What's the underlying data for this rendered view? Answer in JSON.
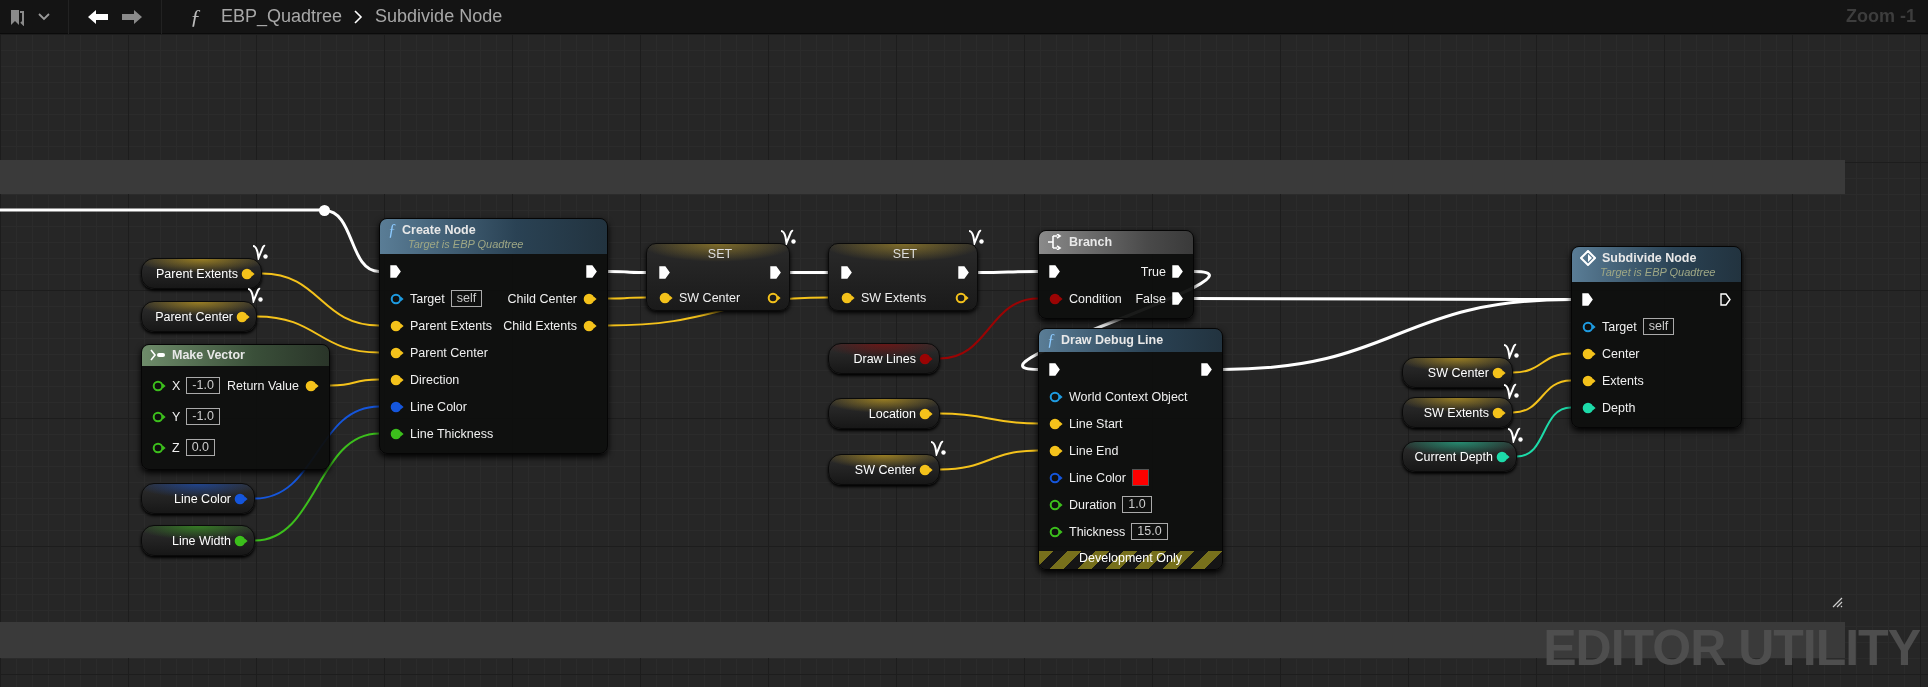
{
  "toolbar": {
    "function_glyph": "ƒ",
    "breadcrumb": [
      {
        "label": "EBP_Quadtree"
      },
      {
        "label": "Subdivide Node"
      }
    ],
    "zoom": "Zoom -1"
  },
  "graph_label": "EDITOR UTILITY",
  "nodes": [
    {
      "kind": "getter",
      "label": "Parent Extents",
      "pin": {
        "kind": "vector",
        "connected": true
      },
      "badge": true
    },
    {
      "kind": "getter",
      "label": "Parent Center",
      "pin": {
        "kind": "vector",
        "connected": true
      },
      "badge": true
    },
    {
      "kind": "struct",
      "title": "Make Vector",
      "rows": [
        {
          "left": {
            "label": "X",
            "kind": "float",
            "connected": false,
            "value": "-1.0"
          },
          "right": {
            "label": "Return Value",
            "kind": "vector",
            "connected": true
          }
        },
        {
          "left": {
            "label": "Y",
            "kind": "float",
            "connected": false,
            "value": "-1.0"
          }
        },
        {
          "left": {
            "label": "Z",
            "kind": "float",
            "connected": false,
            "value": "0.0"
          }
        }
      ]
    },
    {
      "kind": "getter",
      "label": "Line Color",
      "pin": {
        "kind": "linear_color",
        "connected": true
      },
      "badge": false
    },
    {
      "kind": "getter",
      "label": "Line Width",
      "pin": {
        "kind": "float",
        "connected": true
      },
      "badge": false
    },
    {
      "kind": "function",
      "glyph": "ƒ",
      "title": "Create Node",
      "subtitle": "Target is EBP Quadtree",
      "rows": [
        {
          "left": {
            "kind": "exec",
            "connected": true
          },
          "right": {
            "kind": "exec",
            "connected": true
          }
        },
        {
          "left": {
            "label": "Target",
            "kind": "object",
            "connected": false,
            "value": "self"
          },
          "right": {
            "label": "Child Center",
            "kind": "vector",
            "connected": true
          }
        },
        {
          "left": {
            "label": "Parent Extents",
            "kind": "vector",
            "connected": true
          },
          "right": {
            "label": "Child Extents",
            "kind": "vector",
            "connected": true
          }
        },
        {
          "left": {
            "label": "Parent Center",
            "kind": "vector",
            "connected": true
          }
        },
        {
          "left": {
            "label": "Direction",
            "kind": "vector",
            "connected": true
          }
        },
        {
          "left": {
            "label": "Line Color",
            "kind": "linear_color",
            "connected": true
          }
        },
        {
          "left": {
            "label": "Line Thickness",
            "kind": "float",
            "connected": true
          }
        }
      ]
    },
    {
      "kind": "set",
      "title": "SET",
      "badge": true,
      "rows": [
        {
          "left": {
            "kind": "exec",
            "connected": true
          },
          "right": {
            "kind": "exec",
            "connected": true
          }
        },
        {
          "left": {
            "label": "SW Center",
            "kind": "vector",
            "connected": true
          },
          "right": {
            "kind": "vector",
            "connected": false
          }
        }
      ]
    },
    {
      "kind": "set",
      "title": "SET",
      "badge": true,
      "rows": [
        {
          "left": {
            "kind": "exec",
            "connected": true
          },
          "right": {
            "kind": "exec",
            "connected": true
          }
        },
        {
          "left": {
            "label": "SW Extents",
            "kind": "vector",
            "connected": true
          },
          "right": {
            "kind": "vector",
            "connected": false
          }
        }
      ]
    },
    {
      "kind": "branch",
      "title": "Branch",
      "rows": [
        {
          "left": {
            "kind": "exec",
            "connected": true
          },
          "right": {
            "label": "True",
            "kind": "exec",
            "connected": true
          }
        },
        {
          "left": {
            "label": "Condition",
            "kind": "bool",
            "connected": true
          },
          "right": {
            "label": "False",
            "kind": "exec",
            "connected": true
          }
        }
      ]
    },
    {
      "kind": "getter",
      "label": "Draw Lines",
      "pin": {
        "kind": "bool",
        "connected": true
      },
      "badge": false
    },
    {
      "kind": "getter",
      "label": "Location",
      "pin": {
        "kind": "vector",
        "connected": true
      },
      "badge": false
    },
    {
      "kind": "getter",
      "label": "SW Center",
      "pin": {
        "kind": "vector",
        "connected": true
      },
      "badge": true
    },
    {
      "kind": "function",
      "glyph": "ƒ",
      "title": "Draw Debug Line",
      "rows": [
        {
          "left": {
            "kind": "exec",
            "connected": true
          },
          "right": {
            "kind": "exec",
            "connected": true
          }
        },
        {
          "left": {
            "label": "World Context Object",
            "kind": "object",
            "connected": false
          }
        },
        {
          "left": {
            "label": "Line Start",
            "kind": "vector",
            "connected": true
          }
        },
        {
          "left": {
            "label": "Line End",
            "kind": "vector",
            "connected": true
          }
        },
        {
          "left": {
            "label": "Line Color",
            "kind": "linear_color",
            "connected": false,
            "color": "#ff0000"
          }
        },
        {
          "left": {
            "label": "Duration",
            "kind": "float",
            "connected": false,
            "value": "1.0"
          }
        },
        {
          "left": {
            "label": "Thickness",
            "kind": "float",
            "connected": false,
            "value": "15.0"
          }
        }
      ],
      "footer": "Development Only"
    },
    {
      "kind": "getter",
      "label": "SW Center",
      "pin": {
        "kind": "vector",
        "connected": true
      },
      "badge": true
    },
    {
      "kind": "getter",
      "label": "SW Extents",
      "pin": {
        "kind": "vector",
        "connected": true
      },
      "badge": true
    },
    {
      "kind": "getter",
      "label": "Current Depth",
      "pin": {
        "kind": "int",
        "connected": true
      },
      "badge": true
    },
    {
      "kind": "event",
      "title": "Subdivide Node",
      "subtitle": "Target is EBP Quadtree",
      "rows": [
        {
          "left": {
            "kind": "exec",
            "connected": true
          },
          "right": {
            "kind": "exec",
            "connected": false
          }
        },
        {
          "left": {
            "label": "Target",
            "kind": "object",
            "connected": false,
            "value": "self"
          }
        },
        {
          "left": {
            "label": "Center",
            "kind": "vector",
            "connected": true
          }
        },
        {
          "left": {
            "label": "Extents",
            "kind": "vector",
            "connected": true
          }
        },
        {
          "left": {
            "label": "Depth",
            "kind": "int",
            "connected": true
          }
        }
      ]
    }
  ]
}
